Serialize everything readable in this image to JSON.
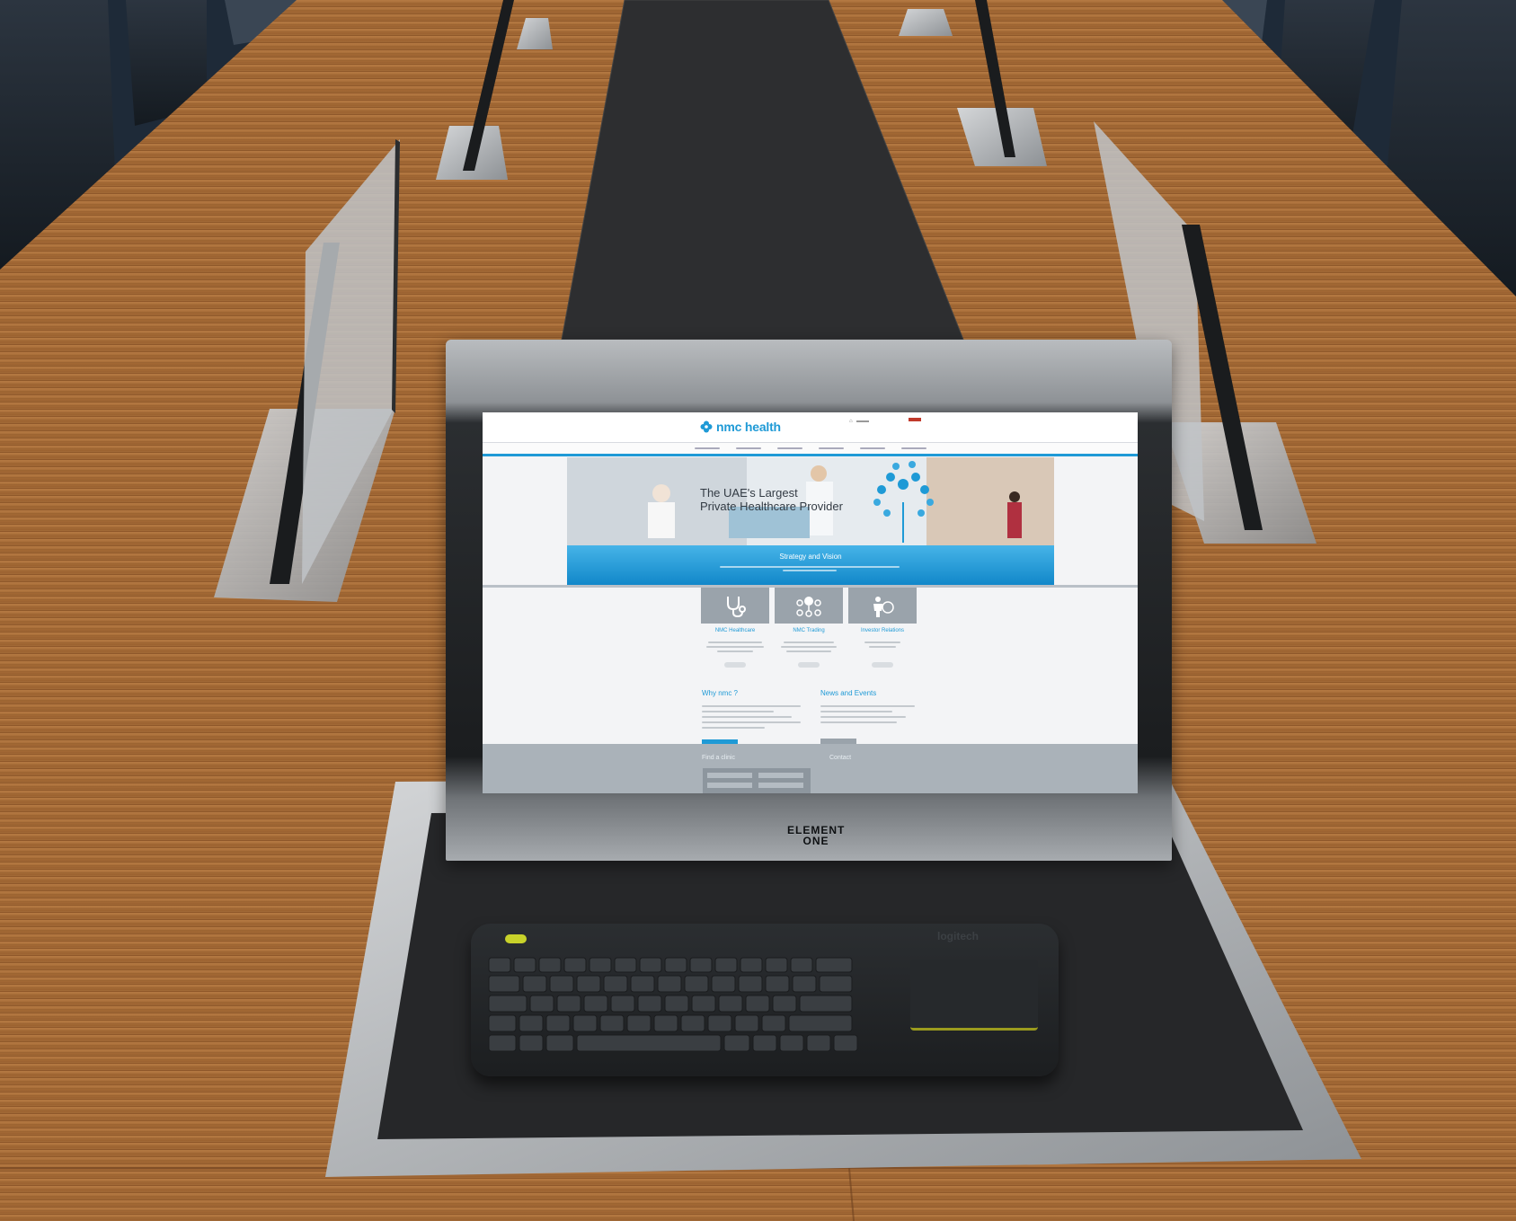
{
  "scene": {
    "monitor_brand": [
      "ELEMENT",
      "ONE"
    ],
    "keyboard_brand": "logitech"
  },
  "website": {
    "logo_text": "nmc health",
    "hero_heading_line1": "The UAE's Largest",
    "hero_heading_line2": "Private Healthcare Provider",
    "hero_band_title": "Strategy and Vision",
    "tiles": [
      {
        "title": "NMC Healthcare",
        "icon": "stethoscope-icon"
      },
      {
        "title": "NMC Trading",
        "icon": "network-dollar-icon"
      },
      {
        "title": "Investor Relations",
        "icon": "investor-icon"
      }
    ],
    "why_title": "Why nmc ?",
    "news_title": "News and Events",
    "find_title": "Find a clinic",
    "contact_title": "Contact"
  },
  "colors": {
    "brand_blue": "#1f9ad6",
    "tile_grey": "#9aa3ab",
    "table_wood": "#a06a36"
  }
}
